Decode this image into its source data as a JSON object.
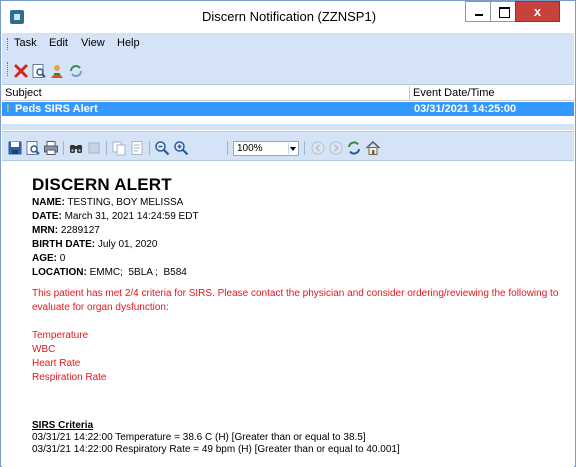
{
  "window": {
    "title": "Discern Notification (ZZNSP1)",
    "close_glyph": "x"
  },
  "menu": [
    "Task",
    "Edit",
    "View",
    "Help"
  ],
  "toolbar_icons": [
    "delete-icon",
    "preview-icon",
    "user-icon",
    "refresh-icon"
  ],
  "list": {
    "headers": {
      "subject": "Subject",
      "event_date": "Event Date/Time"
    },
    "rows": [
      {
        "flag": "!",
        "subject": "Peds SIRS Alert",
        "event_date": "03/31/2021 14:25:00"
      }
    ]
  },
  "viewer": {
    "zoom": "100%"
  },
  "document": {
    "heading": "DISCERN ALERT",
    "fields": {
      "name_label": "NAME:",
      "name_value": " TESTING, BOY MELISSA",
      "date_label": "DATE:",
      "date_value": " March 31, 2021 14:24:59 EDT",
      "mrn_label": "MRN:",
      "mrn_value": " 2289127",
      "birth_label": "BIRTH DATE:",
      "birth_value": " July 01, 2020",
      "age_label": "AGE:",
      "age_value": " 0",
      "location_label": "LOCATION:",
      "location_value": " EMMC;  5BLA ;  B584"
    },
    "message": "This patient has met 2/4 criteria for SIRS. Please contact the physician and consider ordering/reviewing the following to evaluate for organ dysfunction:",
    "items": [
      "Temperature",
      "WBC",
      "Heart Rate",
      "Respiration Rate"
    ],
    "criteria_title": "SIRS Criteria",
    "criteria": [
      "03/31/21 14:22:00 Temperature = 38.6 C (H) [Greater than or equal to 38.5]",
      "03/31/21 14:22:00 Respiratory Rate = 49 bpm (H) [Greater than or equal to 40.001]"
    ]
  },
  "colors": {
    "selection": "#3399ff",
    "alert_text": "#e2171f",
    "chrome": "#d4e3f5"
  }
}
